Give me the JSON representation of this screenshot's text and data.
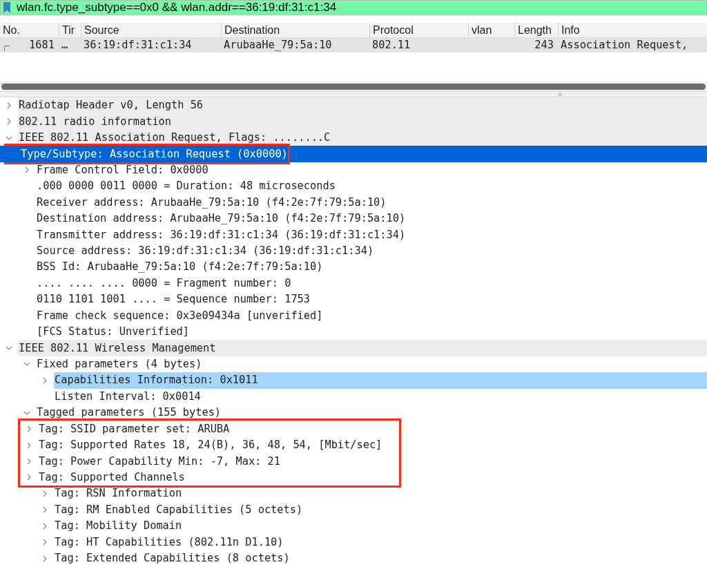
{
  "filter": {
    "value": "wlan.fc.type_subtype==0x0 && wlan.addr==36:19:df:31:c1:34"
  },
  "packet_list": {
    "columns": [
      "No.",
      "Tir",
      "Source",
      "Destination",
      "Protocol",
      "vlan",
      "Length",
      "Info"
    ],
    "rows": [
      {
        "cells": [
          "1681",
          "…",
          "36:19:df:31:c1:34",
          "ArubaaHe_79:5a:10",
          "802.11",
          "",
          "243",
          "Association Request,"
        ]
      }
    ]
  },
  "details": [
    {
      "label": "Radiotap Header v0, Length 56",
      "expanded": false,
      "selected": false,
      "highlighted": false,
      "boxed": false
    },
    {
      "label": "802.11 radio information",
      "expanded": false,
      "selected": false,
      "highlighted": false,
      "boxed": false
    },
    {
      "label": "IEEE 802.11 Association Request, Flags: ........C",
      "expanded": true,
      "selected": false,
      "highlighted": false,
      "boxed": false,
      "children": [
        {
          "label": "Type/Subtype: Association Request (0x0000)",
          "selected": true,
          "highlighted": false,
          "boxed": true
        },
        {
          "label": "Frame Control Field: 0x0000",
          "expanded": false,
          "selected": false,
          "highlighted": false,
          "boxed": false
        },
        {
          "label": ".000 0000 0011 0000 = Duration: 48 microseconds",
          "selected": false,
          "highlighted": false,
          "boxed": false
        },
        {
          "label": "Receiver address: ArubaaHe_79:5a:10 (f4:2e:7f:79:5a:10)",
          "selected": false,
          "highlighted": false,
          "boxed": false
        },
        {
          "label": "Destination address: ArubaaHe_79:5a:10 (f4:2e:7f:79:5a:10)",
          "selected": false,
          "highlighted": false,
          "boxed": false
        },
        {
          "label": "Transmitter address: 36:19:df:31:c1:34 (36:19:df:31:c1:34)",
          "selected": false,
          "highlighted": false,
          "boxed": false
        },
        {
          "label": "Source address: 36:19:df:31:c1:34 (36:19:df:31:c1:34)",
          "selected": false,
          "highlighted": false,
          "boxed": false
        },
        {
          "label": "BSS Id: ArubaaHe_79:5a:10 (f4:2e:7f:79:5a:10)",
          "selected": false,
          "highlighted": false,
          "boxed": false
        },
        {
          "label": ".... .... .... 0000 = Fragment number: 0",
          "selected": false,
          "highlighted": false,
          "boxed": false
        },
        {
          "label": "0110 1101 1001 .... = Sequence number: 1753",
          "selected": false,
          "highlighted": false,
          "boxed": false
        },
        {
          "label": "Frame check sequence: 0x3e09434a [unverified]",
          "selected": false,
          "highlighted": false,
          "boxed": false
        },
        {
          "label": "[FCS Status: Unverified]",
          "selected": false,
          "highlighted": false,
          "boxed": false
        }
      ]
    },
    {
      "label": "IEEE 802.11 Wireless Management",
      "expanded": true,
      "selected": false,
      "highlighted": false,
      "boxed": false,
      "children": [
        {
          "label": "Fixed parameters (4 bytes)",
          "expanded": true,
          "selected": false,
          "highlighted": false,
          "boxed": false,
          "children": [
            {
              "label": "Capabilities Information: 0x1011",
              "expanded": false,
              "selected": false,
              "highlighted": true,
              "boxed": false
            },
            {
              "label": "Listen Interval: 0x0014",
              "selected": false,
              "highlighted": false,
              "boxed": false
            }
          ]
        },
        {
          "label": "Tagged parameters (155 bytes)",
          "expanded": true,
          "selected": false,
          "highlighted": false,
          "boxed": false,
          "children": [
            {
              "label": "Tag: SSID parameter set: ARUBA",
              "expanded": false,
              "selected": false,
              "highlighted": false,
              "boxed": true
            },
            {
              "label": "Tag: Supported Rates 18, 24(B), 36, 48, 54, [Mbit/sec]",
              "expanded": false,
              "selected": false,
              "highlighted": false,
              "boxed": true
            },
            {
              "label": "Tag: Power Capability Min: -7, Max: 21",
              "expanded": false,
              "selected": false,
              "highlighted": false,
              "boxed": true
            },
            {
              "label": "Tag: Supported Channels",
              "expanded": false,
              "selected": false,
              "highlighted": false,
              "boxed": true
            },
            {
              "label": "Tag: RSN Information",
              "expanded": false,
              "selected": false,
              "highlighted": false,
              "boxed": false
            },
            {
              "label": "Tag: RM Enabled Capabilities (5 octets)",
              "expanded": false,
              "selected": false,
              "highlighted": false,
              "boxed": false
            },
            {
              "label": "Tag: Mobility Domain",
              "expanded": false,
              "selected": false,
              "highlighted": false,
              "boxed": false
            },
            {
              "label": "Tag: HT Capabilities (802.11n D1.10)",
              "expanded": false,
              "selected": false,
              "highlighted": false,
              "boxed": false
            },
            {
              "label": "Tag: Extended Capabilities (8 octets)",
              "expanded": false,
              "selected": false,
              "highlighted": false,
              "boxed": false
            }
          ]
        }
      ]
    }
  ]
}
